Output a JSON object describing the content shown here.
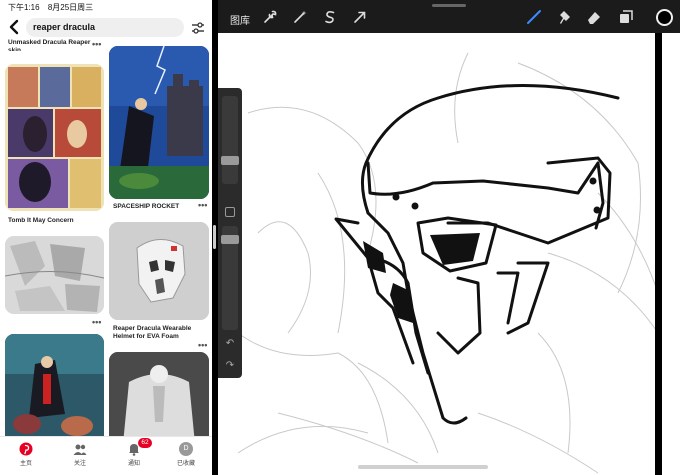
{
  "status_bar": {
    "time": "下午1:16",
    "date": "8月25日周三"
  },
  "search": {
    "query": "reaper dracula"
  },
  "pins": [
    {
      "caption": "Unmasked Dracula Reaper skin",
      "menu": "•••"
    },
    {
      "caption": "SPACESHIP ROCKET",
      "menu": "•••"
    },
    {
      "caption": "Tomb It May Concern",
      "menu": "•••"
    },
    {
      "caption": "Reaper Dracula Wearable Helmet for EVA Foam",
      "menu": "•••"
    },
    {
      "caption": "",
      "menu": "•••"
    }
  ],
  "tabbar": {
    "tabs": [
      {
        "label": "主页"
      },
      {
        "label": "关注"
      },
      {
        "label": "通知"
      },
      {
        "label": "已收藏"
      }
    ],
    "notification_count": "62",
    "avatar_letter": "D"
  },
  "procreate": {
    "gallery_label": "图库",
    "colors": {
      "topbar": "#1b1b1b",
      "active_tool": "#3d8bff",
      "current_color": "#000000"
    }
  }
}
